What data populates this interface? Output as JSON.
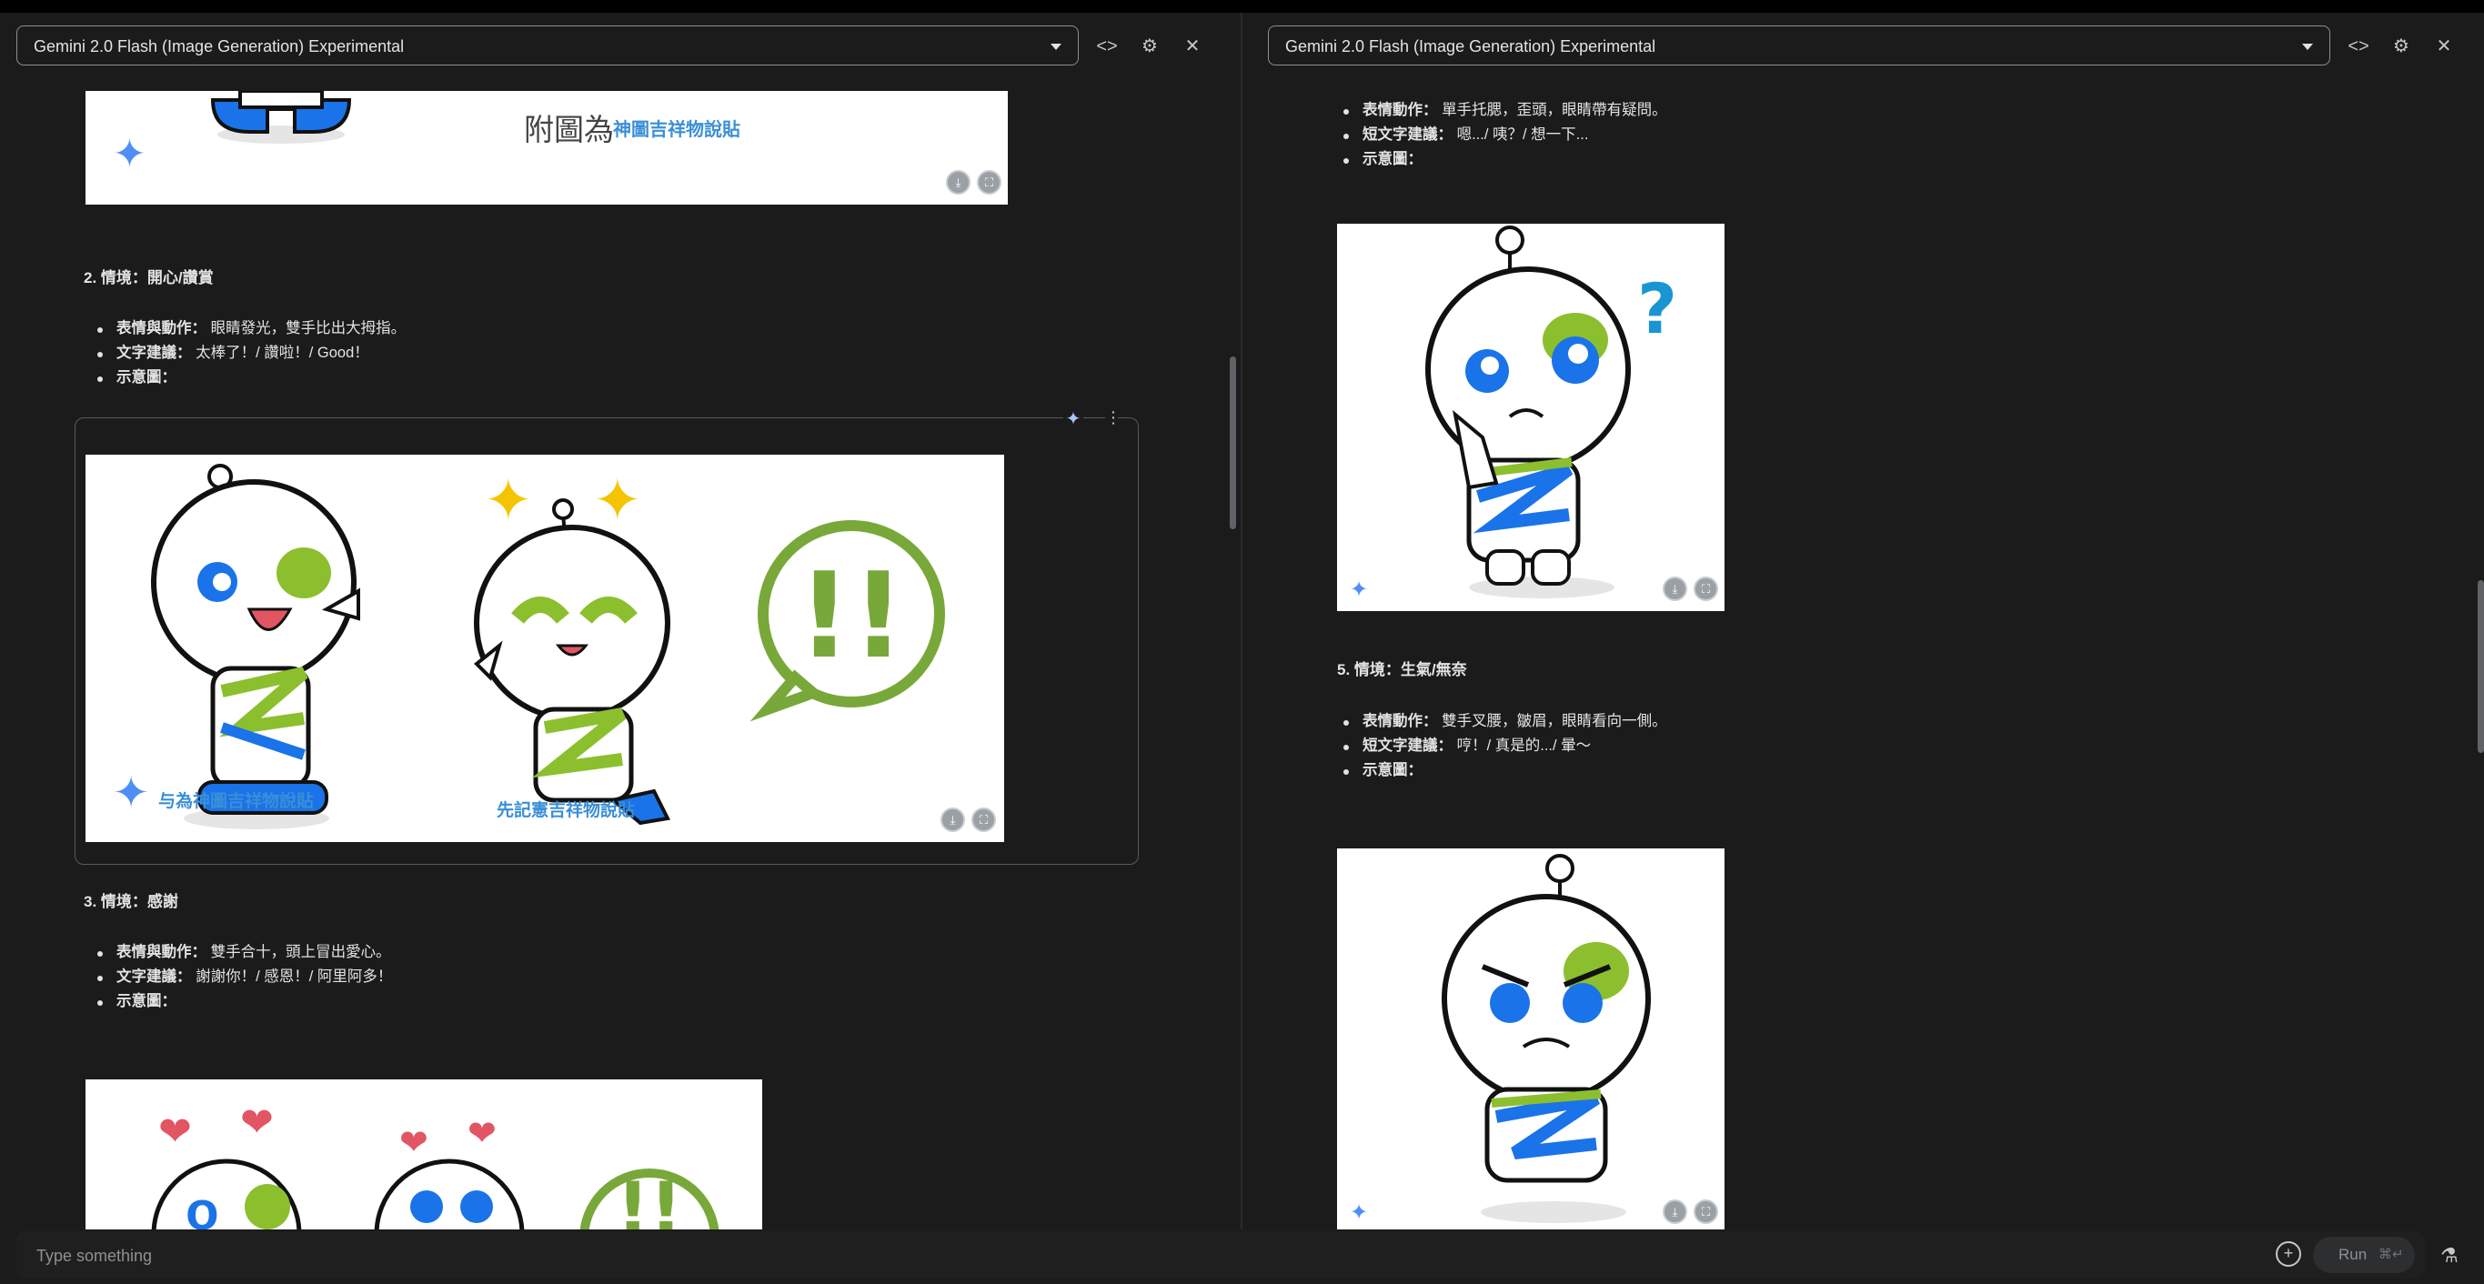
{
  "left_panel": {
    "model_name": "Gemini 2.0 Flash (Image Generation) Experimental",
    "icons": [
      "code-icon",
      "gear-icon",
      "close-icon"
    ],
    "top_image": {
      "main_text": "附圖為",
      "garbled_text": "神圖吉祥物說貼"
    },
    "section2": {
      "heading": "2. 情境：開心/讚賞",
      "bullets": [
        {
          "label": "表情與動作：",
          "text": " 眼睛發光，雙手比出大拇指。"
        },
        {
          "label": "文字建議：",
          "text": " 太棒了！/ 讚啦！/ Good！"
        },
        {
          "label": "示意圖：",
          "text": ""
        }
      ],
      "image_captions": [
        "与為神圖吉祥物說貼",
        "先記憲吉祥物說貼"
      ],
      "exclaim": "!!"
    },
    "section3": {
      "heading": "3. 情境：感謝",
      "bullets": [
        {
          "label": "表情與動作：",
          "text": " 雙手合十，頭上冒出愛心。"
        },
        {
          "label": "文字建議：",
          "text": " 謝謝你！/ 感恩！/ 阿里阿多！"
        },
        {
          "label": "示意圖：",
          "text": ""
        }
      ]
    }
  },
  "right_panel": {
    "model_name": "Gemini 2.0 Flash (Image Generation) Experimental",
    "section4_tail": {
      "bullets": [
        {
          "label": "表情動作：",
          "text": " 單手托腮，歪頭，眼睛帶有疑問。"
        },
        {
          "label": "短文字建議：",
          "text": " 嗯.../ 咦？/ 想一下..."
        },
        {
          "label": "示意圖：",
          "text": ""
        }
      ]
    },
    "section5": {
      "heading": "5. 情境：生氣/無奈",
      "bullets": [
        {
          "label": "表情動作：",
          "text": " 雙手叉腰，皺眉，眼睛看向一側。"
        },
        {
          "label": "短文字建議：",
          "text": " 哼！/ 真是的.../ 暈～"
        },
        {
          "label": "示意圖：",
          "text": ""
        }
      ]
    }
  },
  "input": {
    "placeholder": "Type something"
  },
  "run": {
    "label": "Run",
    "shortcut": "⌘↵"
  }
}
